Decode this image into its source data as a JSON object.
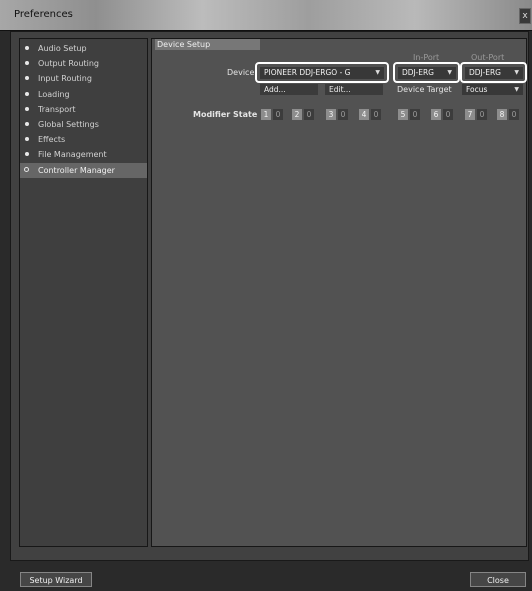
{
  "window": {
    "title": "Preferences",
    "close_glyph": "x"
  },
  "sidebar": {
    "items": [
      {
        "label": "Audio Setup"
      },
      {
        "label": "Output Routing"
      },
      {
        "label": "Input Routing"
      },
      {
        "label": "Loading"
      },
      {
        "label": "Transport"
      },
      {
        "label": "Global Settings"
      },
      {
        "label": "Effects"
      },
      {
        "label": "File Management"
      },
      {
        "label": "Controller Manager",
        "active": true
      }
    ]
  },
  "device_setup": {
    "tab_label": "Device Setup",
    "in_port_label": "In-Port",
    "out_port_label": "Out-Port",
    "device_label": "Device",
    "device_value": "PIONEER DDJ-ERGO - G",
    "in_port_value": "DDJ-ERG",
    "out_port_value": "DDJ-ERG",
    "add_label": "Add...",
    "edit_label": "Edit...",
    "device_target_label": "Device Target",
    "focus_value": "Focus",
    "modifier_state_label": "Modifier State",
    "modifiers": [
      {
        "num": "1",
        "val": "0"
      },
      {
        "num": "2",
        "val": "0"
      },
      {
        "num": "3",
        "val": "0"
      },
      {
        "num": "4",
        "val": "0"
      },
      {
        "num": "5",
        "val": "0"
      },
      {
        "num": "6",
        "val": "0"
      },
      {
        "num": "7",
        "val": "0"
      },
      {
        "num": "8",
        "val": "0"
      }
    ]
  },
  "footer": {
    "setup_wizard_label": "Setup Wizard",
    "close_label": "Close"
  },
  "icons": {
    "sidebar_bullet": "bullet-icon",
    "active_item": "circle-icon",
    "dropdown": "chevron-down-icon"
  },
  "colors": {
    "highlight_ring": "#ffffff",
    "active_item_bg": "#666666",
    "modifier_num_bg": "#8d8d8d"
  }
}
